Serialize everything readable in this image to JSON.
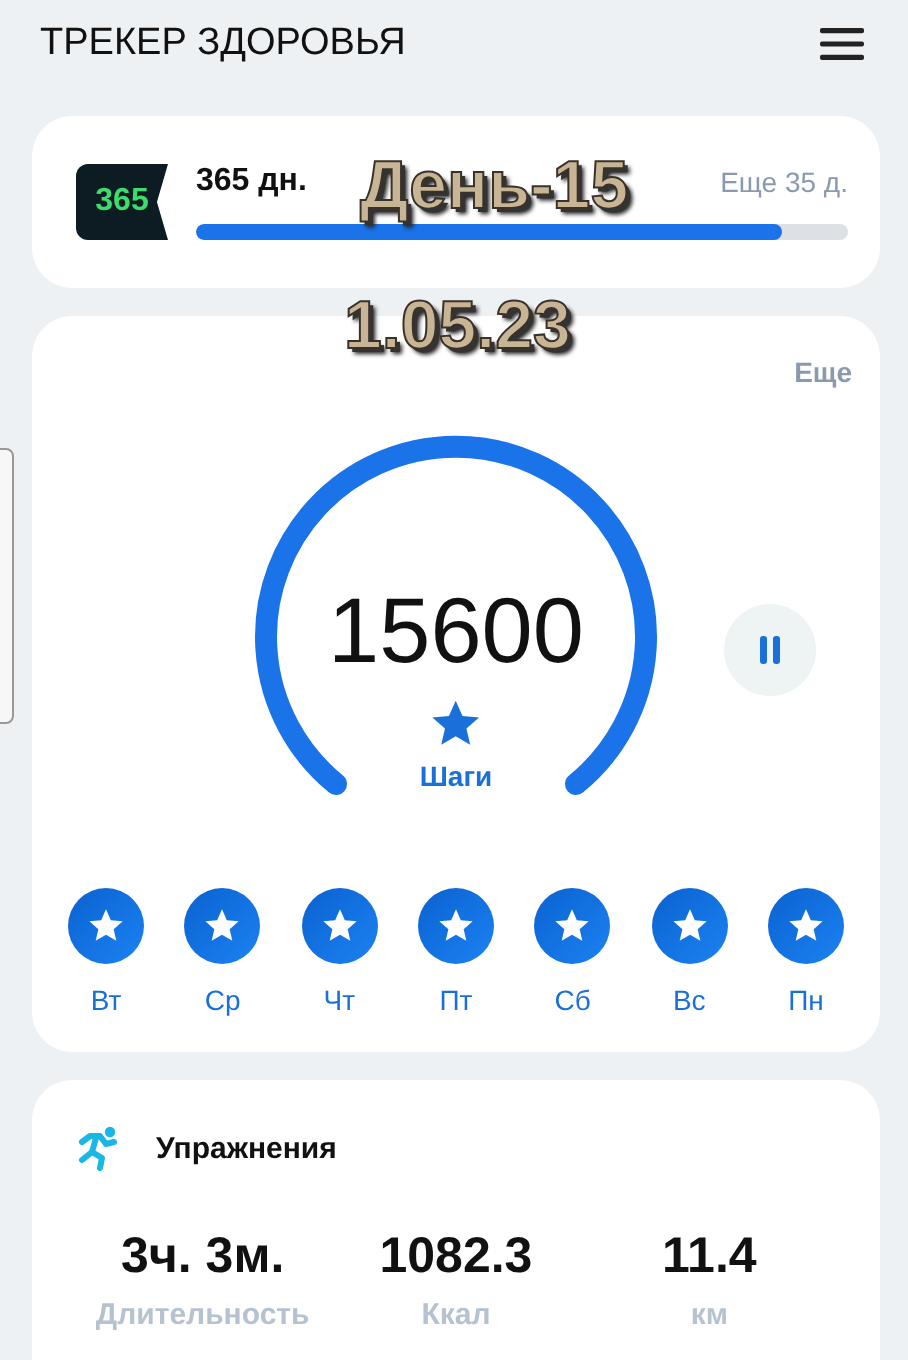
{
  "header": {
    "title": "ТРЕКЕР ЗДОРОВЬЯ"
  },
  "challenge": {
    "badge": "365",
    "label": "365 дн.",
    "remaining": "Еще 35 д.",
    "level": 0.9
  },
  "overlay": {
    "day": "День-15",
    "date": "1.05.23"
  },
  "steps": {
    "more": "Еще",
    "count": "15600",
    "label": "Шаги",
    "paused": false
  },
  "days": [
    {
      "label": "Вт",
      "achieved": true
    },
    {
      "label": "Ср",
      "achieved": true
    },
    {
      "label": "Чт",
      "achieved": true
    },
    {
      "label": "Пт",
      "achieved": true
    },
    {
      "label": "Сб",
      "achieved": true
    },
    {
      "label": "Вс",
      "achieved": true
    },
    {
      "label": "Пн",
      "achieved": true
    }
  ],
  "exercise": {
    "title": "Упражнения",
    "stats": [
      {
        "value": "3ч. 3м.",
        "label": "Длительность"
      },
      {
        "value": "1082.3",
        "label": "Ккал"
      },
      {
        "value": "11.4",
        "label": "км"
      }
    ]
  }
}
